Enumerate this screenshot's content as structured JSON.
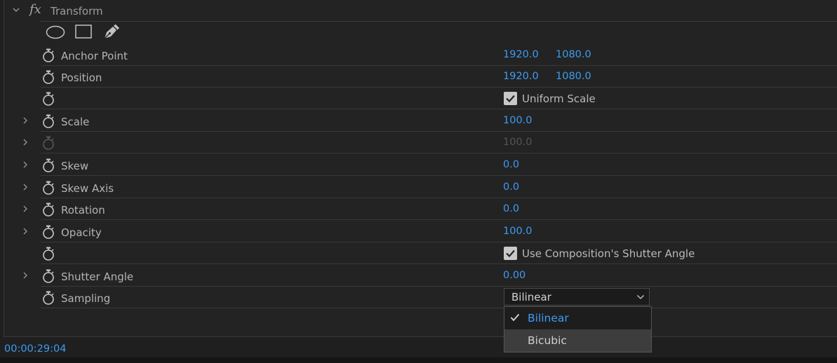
{
  "effect": {
    "title": "Transform",
    "fx_label": "fx"
  },
  "mask_tools": [
    "ellipse-mask-icon",
    "rectangle-mask-icon",
    "pen-mask-icon"
  ],
  "properties": [
    {
      "label": "Anchor Point",
      "v1": "1920.0",
      "v2": "1080.0"
    },
    {
      "label": "Position",
      "v1": "1920.0",
      "v2": "1080.0"
    },
    {
      "checkbox": "Uniform Scale",
      "checked": true
    },
    {
      "label": "Scale",
      "v1": "100.0"
    },
    {
      "v1": "100.0",
      "disabled": true
    },
    {
      "label": "Skew",
      "v1": "0.0"
    },
    {
      "label": "Skew Axis",
      "v1": "0.0"
    },
    {
      "label": "Rotation",
      "v1": "0.0"
    },
    {
      "label": "Opacity",
      "v1": "100.0"
    },
    {
      "checkbox": "Use Composition's Shutter Angle",
      "checked": true
    },
    {
      "label": "Shutter Angle",
      "v1": "0.00"
    },
    {
      "label": "Sampling"
    }
  ],
  "sampling": {
    "value": "Bilinear",
    "options": [
      "Bilinear",
      "Bicubic"
    ]
  },
  "timecode": "00:00:29:04",
  "colors": {
    "accent": "#3d9bf4",
    "background": "#232323",
    "text": "#b4b4b4"
  }
}
